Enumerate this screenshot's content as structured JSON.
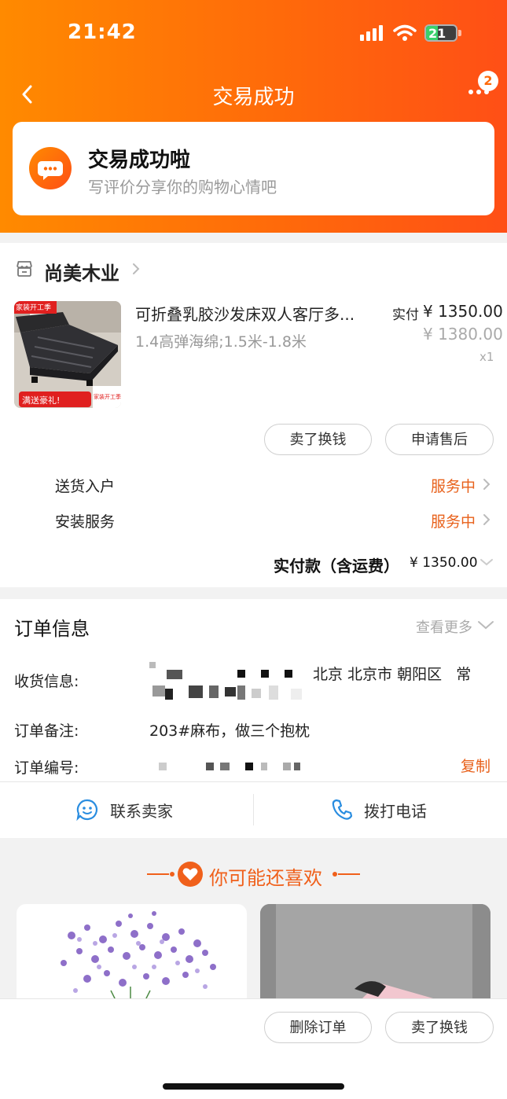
{
  "status_bar": {
    "time": "21:42",
    "battery": "21"
  },
  "nav": {
    "title": "交易成功",
    "badge_count": "2"
  },
  "success": {
    "title": "交易成功啦",
    "subtitle": "写评价分享你的购物心情吧"
  },
  "shop": {
    "name": "尚美木业"
  },
  "product": {
    "title": "可折叠乳胶沙发床双人客厅多...",
    "spec": "1.4高弹海绵;1.5米-1.8米",
    "paid_label": "实付",
    "paid_price": "¥ 1350.00",
    "original_price": "¥ 1380.00",
    "quantity": "x1",
    "image_badge_top": "家装开工季",
    "image_badge_bottom": "满送豪礼!",
    "image_badge_corner": "家装开工季"
  },
  "item_actions": {
    "sell_label": "卖了换钱",
    "after_sale_label": "申请售后"
  },
  "services": [
    {
      "label": "送货入户",
      "status": "服务中"
    },
    {
      "label": "安装服务",
      "status": "服务中"
    }
  ],
  "total": {
    "label": "实付款（含运费）",
    "value": "¥ 1350.00"
  },
  "order_info": {
    "title": "订单信息",
    "see_more": "查看更多",
    "receiver_label": "收货信息:",
    "receiver_value": "北京 北京市 朝阳区   常",
    "note_label": "订单备注:",
    "note_value": "203#麻布，做三个抱枕",
    "order_no_label": "订单编号:",
    "copy_label": "复制"
  },
  "contact": {
    "seller_label": "联系卖家",
    "phone_label": "拨打电话"
  },
  "recommend": {
    "title": "你可能还喜欢"
  },
  "bottom": {
    "delete_label": "删除订单",
    "sell_label": "卖了换钱"
  },
  "colors": {
    "accent": "#ff6a0a",
    "status_orange": "#e8611b",
    "contact_blue": "#2a8de0"
  }
}
